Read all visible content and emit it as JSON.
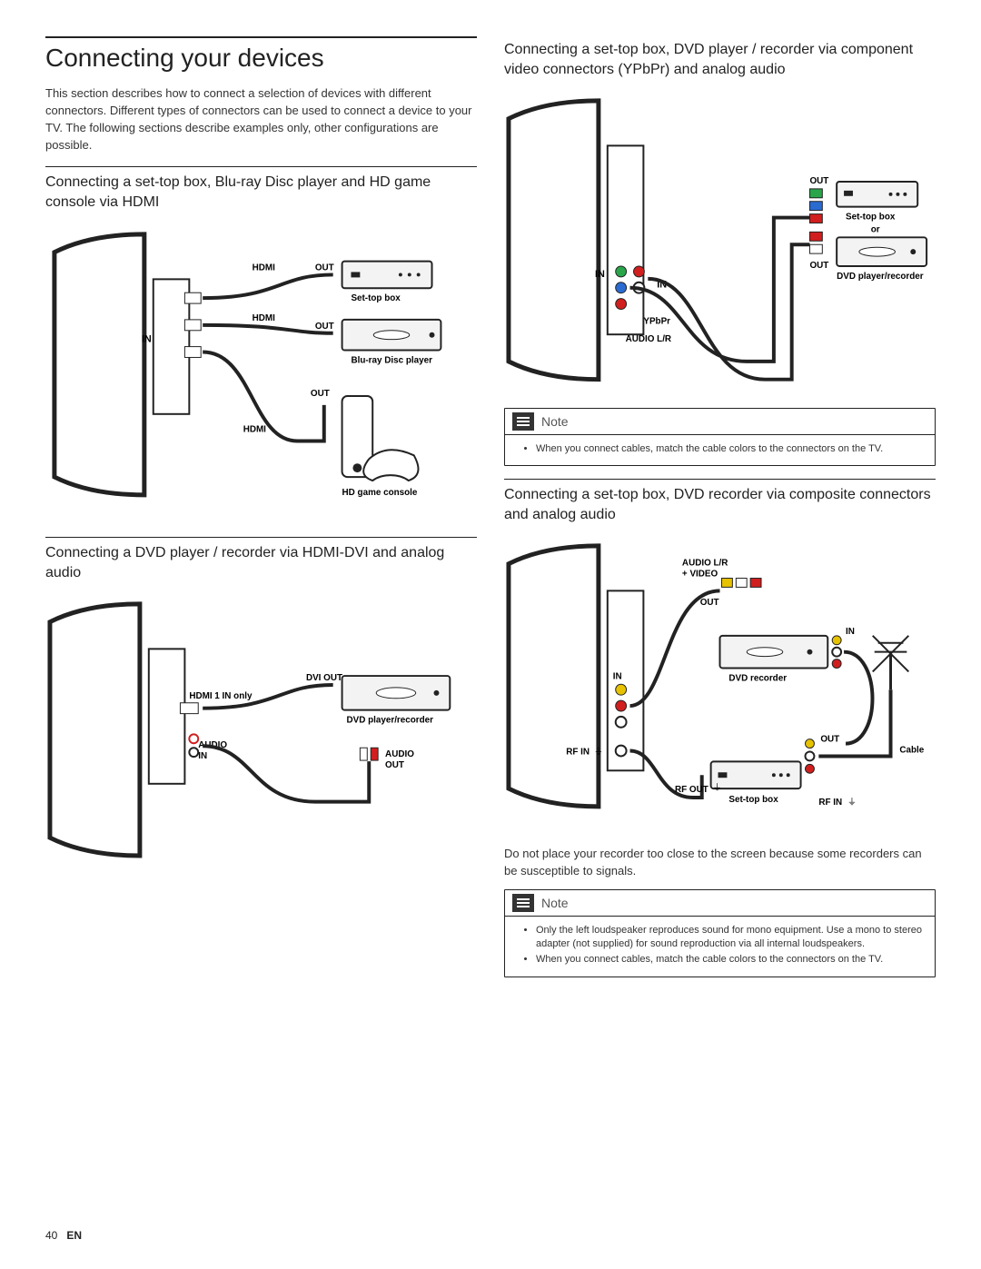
{
  "page_title": "Connecting your devices",
  "intro": "This section describes how to connect a selection of devices with different connectors. Different types of connectors can be used to connect a device to your TV. The following sections describe examples only, other configurations are possible.",
  "sections": [
    {
      "heading": "Connecting a set-top box, Blu-ray Disc player and HD game console via HDMI",
      "diagram": {
        "labels": {
          "in": "IN",
          "hdmi": "HDMI",
          "out": "OUT",
          "settop": "Set-top box",
          "bluray": "Blu-ray Disc player",
          "console": "HD game console"
        }
      }
    },
    {
      "heading": "Connecting a DVD player / recorder via HDMI-DVI and analog audio",
      "diagram": {
        "labels": {
          "hdmi1": "HDMI 1 IN only",
          "audio_in": "AUDIO IN",
          "dvi_out": "DVI OUT",
          "dvd": "DVD player/recorder",
          "audio_out": "AUDIO OUT"
        }
      }
    },
    {
      "heading": "Connecting a set-top box, DVD player / recorder via component video connectors (YPbPr) and analog audio",
      "diagram": {
        "labels": {
          "in": "IN",
          "ypbpr": "YPbPr",
          "audio_lr": "AUDIO L/R",
          "out": "OUT",
          "settop": "Set-top box",
          "or": "or",
          "dvd": "DVD player/recorder"
        }
      },
      "note": {
        "label": "Note",
        "items": [
          "When you connect cables, match the cable colors to the connectors on the TV."
        ]
      }
    },
    {
      "heading": "Connecting a set-top box, DVD recorder via composite connectors and analog audio",
      "diagram": {
        "labels": {
          "audio_lr_video": "AUDIO L/R + VIDEO",
          "out": "OUT",
          "in": "IN",
          "dvd_rec": "DVD recorder",
          "rf_in": "RF IN",
          "rf_out": "RF OUT",
          "settop": "Set-top box",
          "cable": "Cable"
        }
      },
      "body_after": "Do not place your recorder too close to the screen because some recorders can be susceptible to signals.",
      "note": {
        "label": "Note",
        "items": [
          "Only the left loudspeaker reproduces sound for mono equipment. Use a mono to stereo adapter (not supplied) for sound reproduction via all internal loudspeakers.",
          "When you connect cables, match the cable colors to the connectors on the TV."
        ]
      }
    }
  ],
  "footer": {
    "page": "40",
    "lang": "EN"
  },
  "colors": {
    "green": "#2aa54a",
    "blue": "#2a6bd1",
    "red": "#d11e1e",
    "yellow": "#e6c200",
    "white": "#ffffff",
    "grey": "#c9c9c9",
    "black": "#222222"
  }
}
